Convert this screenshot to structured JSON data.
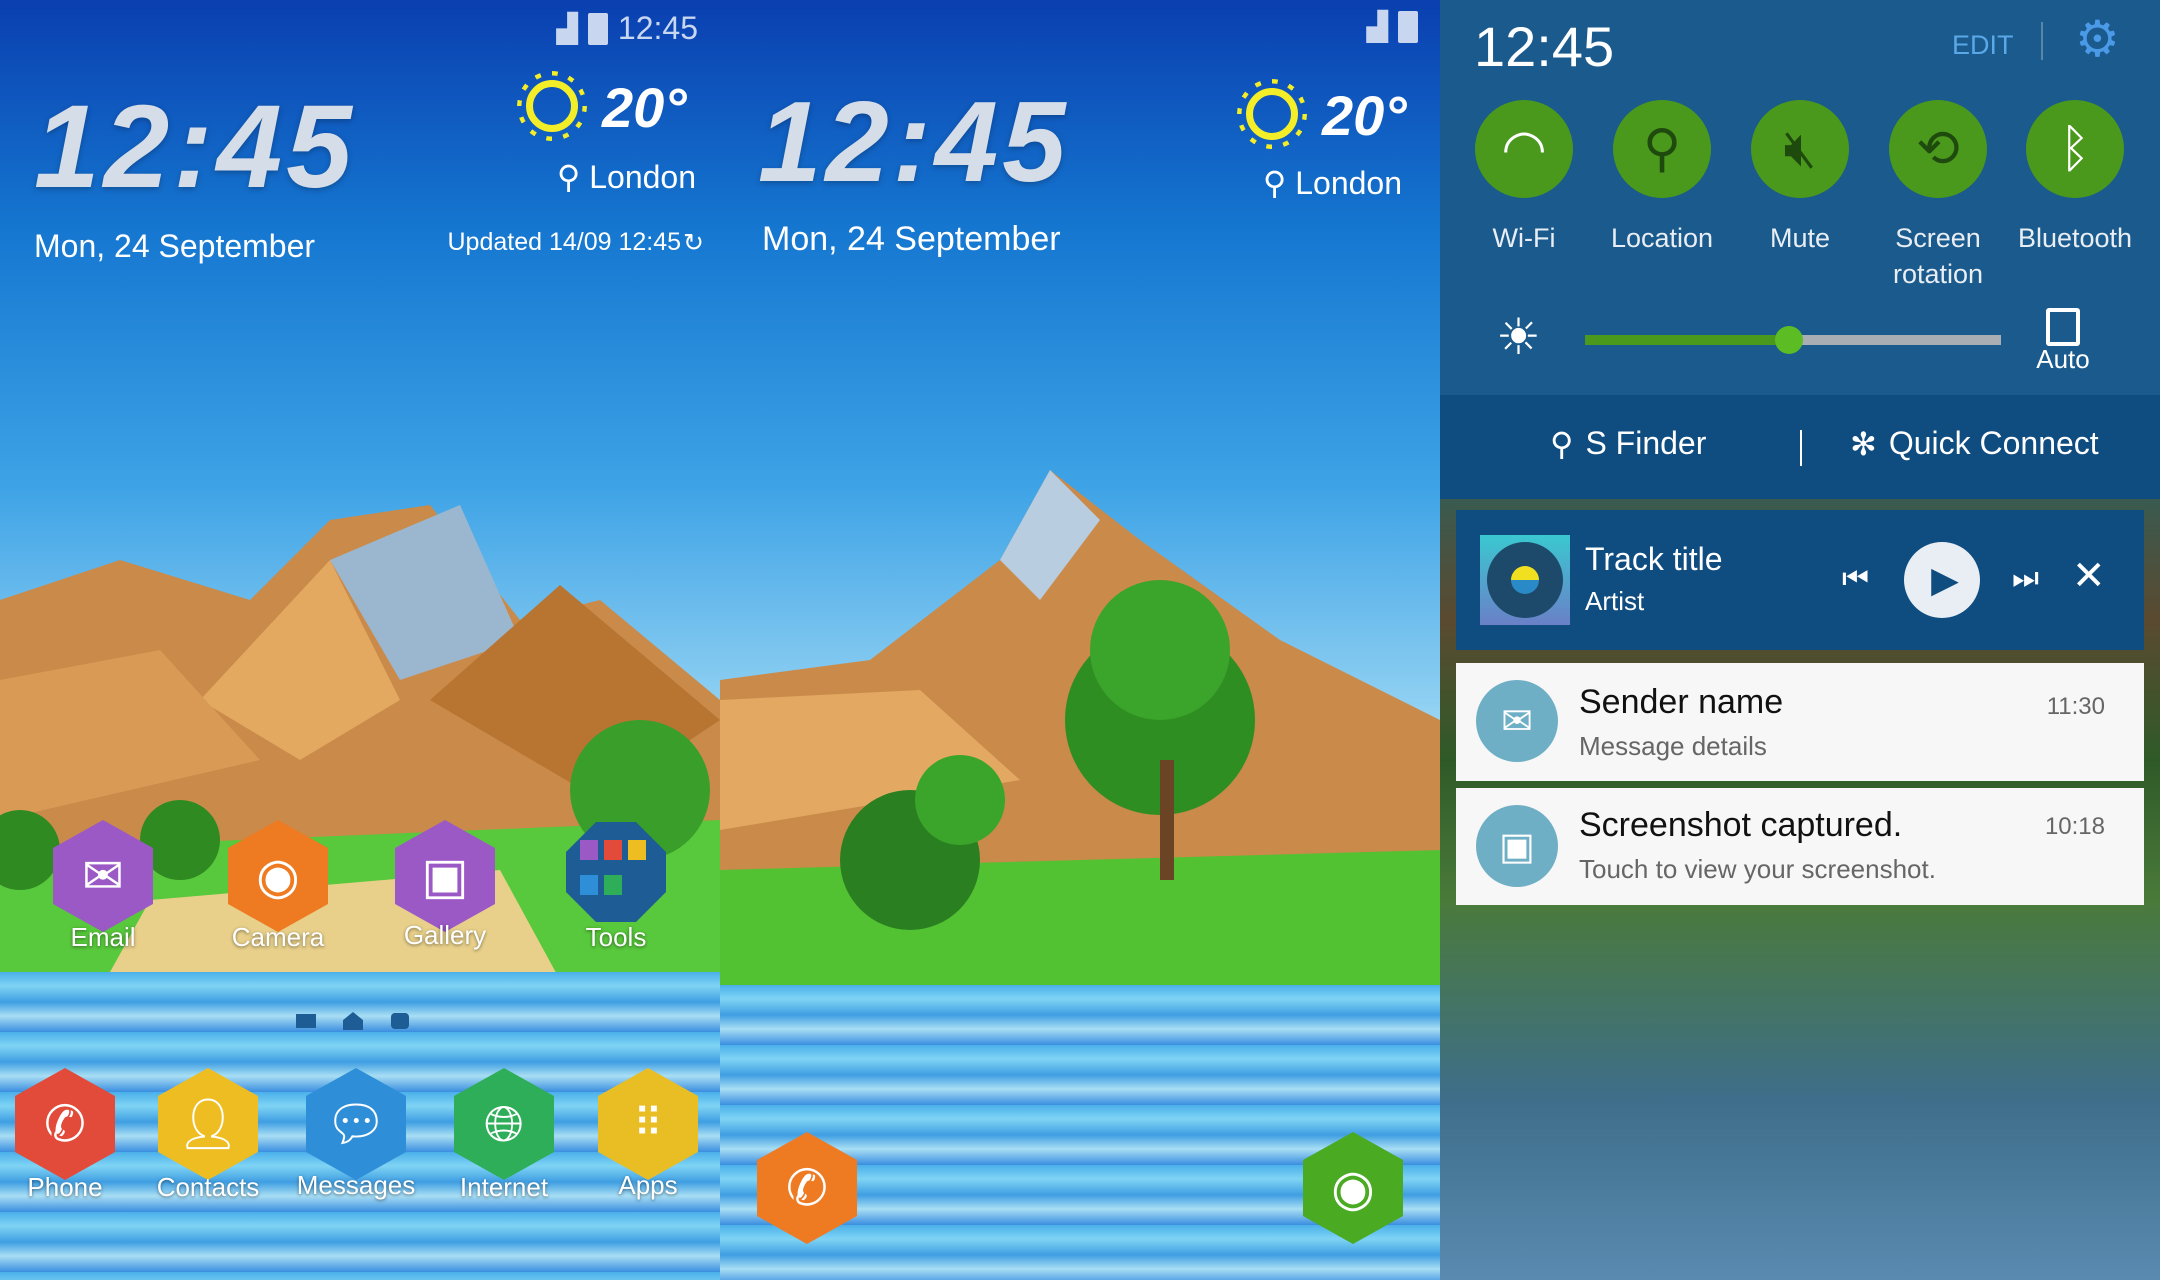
{
  "home_screen": {
    "status": {
      "time": "12:45",
      "signal_icon": "signal-icon",
      "battery_icon": "battery-icon"
    },
    "clock": "12:45",
    "temperature": "20°",
    "location": "London",
    "date": "Mon, 24 September",
    "updated": "Updated 14/09 12:45",
    "apps": [
      {
        "label": "Email",
        "color": "#9b59c6",
        "icon": "envelope-icon"
      },
      {
        "label": "Camera",
        "color": "#ee7a22",
        "icon": "camera-icon"
      },
      {
        "label": "Gallery",
        "color": "#9b59c6",
        "icon": "picture-icon"
      },
      {
        "label": "Tools",
        "color": "#1d5c94",
        "icon": "folder-icon"
      }
    ],
    "dock": [
      {
        "label": "Phone",
        "color": "#e24a3a"
      },
      {
        "label": "Contacts",
        "color": "#edbd22"
      },
      {
        "label": "Messages",
        "color": "#2e8ed8"
      },
      {
        "label": "Internet",
        "color": "#2fae5a"
      },
      {
        "label": "Apps",
        "color": "#e9bd24"
      }
    ]
  },
  "lock_screen": {
    "clock": "12:45",
    "temperature": "20°",
    "location": "London",
    "date": "Mon, 24 September",
    "phone_color": "#ee7a22",
    "camera_color": "#4aaa22"
  },
  "notification_panel": {
    "time": "12:45",
    "edit": "EDIT",
    "toggles": [
      {
        "label": "Wi-Fi",
        "on": true
      },
      {
        "label": "Location",
        "on": true
      },
      {
        "label": "Mute",
        "on": true
      },
      {
        "label": "Screen rotation",
        "on": true
      },
      {
        "label": "Bluetooth",
        "on": true
      }
    ],
    "brightness": 0.49,
    "auto_label": "Auto",
    "auto_checked": false,
    "s_finder": "S Finder",
    "quick_connect": "Quick Connect",
    "media": {
      "title": "Track title",
      "artist": "Artist"
    },
    "notifications": [
      {
        "title": "Sender name",
        "detail": "Message details",
        "time": "11:30",
        "icon": "envelope-icon"
      },
      {
        "title": "Screenshot captured.",
        "detail": "Touch to view your screenshot.",
        "time": "10:18",
        "icon": "image-icon"
      }
    ],
    "accent": "#4a981c",
    "panel_color": "#1a5a8c"
  }
}
